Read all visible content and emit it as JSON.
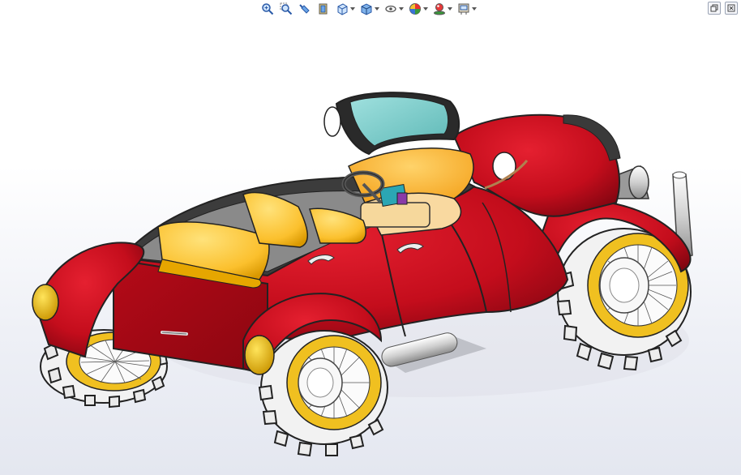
{
  "toolbar": {
    "items": [
      {
        "icon": "zoom-to-fit-icon",
        "dropdown": false
      },
      {
        "icon": "zoom-to-area-icon",
        "dropdown": false
      },
      {
        "icon": "previous-view-icon",
        "dropdown": false
      },
      {
        "icon": "section-view-icon",
        "dropdown": false
      },
      {
        "icon": "view-orientation-icon",
        "dropdown": true
      },
      {
        "icon": "display-style-icon",
        "dropdown": true
      },
      {
        "icon": "hide-show-items-icon",
        "dropdown": true
      },
      {
        "icon": "edit-appearance-icon",
        "dropdown": true
      },
      {
        "icon": "apply-scene-icon",
        "dropdown": true
      },
      {
        "icon": "view-settings-icon",
        "dropdown": true
      }
    ]
  },
  "window_controls": [
    "restore-icon",
    "close-icon"
  ],
  "colors": {
    "body_red": "#c40d1c",
    "body_red_dark": "#8c0610",
    "interior_yellow": "#fdc93a",
    "interior_orange": "#f7a21a",
    "windshield": "#7fd0cf",
    "wheel_yellow": "#f0c020",
    "tire": "#f2f2f2",
    "lamp_yellow": "#e8b800",
    "chrome": "#d8d8d8"
  }
}
